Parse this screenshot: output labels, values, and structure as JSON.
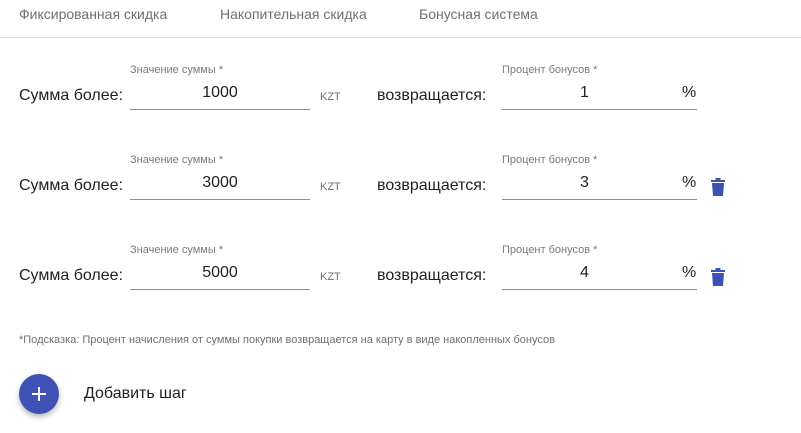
{
  "tabs": [
    {
      "label": "Фиксированная скидка"
    },
    {
      "label": "Накопительная скидка"
    },
    {
      "label": "Бонусная система"
    }
  ],
  "steps": [
    {
      "amount_label": "Сумма более:",
      "amount_caption": "Значение суммы *",
      "amount_value": "1000",
      "currency": "KZT",
      "returns_label": "возвращается:",
      "percent_caption": "Процент бонусов *",
      "percent_value": "1",
      "percent_suffix": "%",
      "deletable": false
    },
    {
      "amount_label": "Сумма более:",
      "amount_caption": "Значение суммы *",
      "amount_value": "3000",
      "currency": "KZT",
      "returns_label": "возвращается:",
      "percent_caption": "Процент бонусов *",
      "percent_value": "3",
      "percent_suffix": "%",
      "deletable": true
    },
    {
      "amount_label": "Сумма более:",
      "amount_caption": "Значение суммы *",
      "amount_value": "5000",
      "currency": "KZT",
      "returns_label": "возвращается:",
      "percent_caption": "Процент бонусов *",
      "percent_value": "4",
      "percent_suffix": "%",
      "deletable": true
    }
  ],
  "hint": "*Подсказка: Процент начисления от суммы покупки возвращается на карту в виде накопленных бонусов",
  "add_step": {
    "label": "Добавить шаг",
    "icon": "plus-icon"
  },
  "delete_icon": "trash-icon",
  "colors": {
    "accent": "#3f51b5",
    "text": "#212121",
    "muted": "#6f6f6f",
    "divider": "#e0e0e0"
  }
}
